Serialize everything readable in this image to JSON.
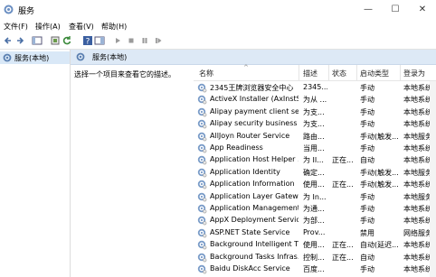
{
  "window": {
    "title": "服务",
    "minimize": "—",
    "maximize": "☐",
    "close": "✕"
  },
  "menu": [
    {
      "label": "文件(F)"
    },
    {
      "label": "操作(A)"
    },
    {
      "label": "查看(V)"
    },
    {
      "label": "帮助(H)"
    }
  ],
  "tree": {
    "item": "服务(本地)"
  },
  "header": {
    "label": "服务(本地)"
  },
  "description": {
    "text": "选择一个项目来查看它的描述。"
  },
  "table": {
    "columns": [
      "名称",
      "描述",
      "状态",
      "启动类型",
      "登录为"
    ],
    "rows": [
      {
        "name": "2345王牌浏览器安全中心",
        "desc": "2345...",
        "status": "",
        "startup": "手动",
        "logon": "本地系统"
      },
      {
        "name": "ActiveX Installer (AxInstSV)",
        "desc": "为从 ...",
        "status": "",
        "startup": "手动",
        "logon": "本地系统"
      },
      {
        "name": "Alipay payment client sec...",
        "desc": "为支...",
        "status": "",
        "startup": "手动",
        "logon": "本地系统"
      },
      {
        "name": "Alipay security business s...",
        "desc": "为支...",
        "status": "",
        "startup": "手动",
        "logon": "本地系统"
      },
      {
        "name": "AllJoyn Router Service",
        "desc": "路由...",
        "status": "",
        "startup": "手动(触发...",
        "logon": "本地服务"
      },
      {
        "name": "App Readiness",
        "desc": "当用...",
        "status": "",
        "startup": "手动",
        "logon": "本地系统"
      },
      {
        "name": "Application Host Helper ...",
        "desc": "为 II...",
        "status": "正在...",
        "startup": "自动",
        "logon": "本地系统"
      },
      {
        "name": "Application Identity",
        "desc": "确定...",
        "status": "",
        "startup": "手动(触发...",
        "logon": "本地服务"
      },
      {
        "name": "Application Information",
        "desc": "使用...",
        "status": "正在...",
        "startup": "手动(触发...",
        "logon": "本地系统"
      },
      {
        "name": "Application Layer Gatewa...",
        "desc": "为 In...",
        "status": "",
        "startup": "手动",
        "logon": "本地服务"
      },
      {
        "name": "Application Management",
        "desc": "为通...",
        "status": "",
        "startup": "手动",
        "logon": "本地系统"
      },
      {
        "name": "AppX Deployment Servic...",
        "desc": "为部...",
        "status": "",
        "startup": "手动",
        "logon": "本地系统"
      },
      {
        "name": "ASP.NET State Service",
        "desc": "Prov...",
        "status": "",
        "startup": "禁用",
        "logon": "网络服务"
      },
      {
        "name": "Background Intelligent T...",
        "desc": "使用...",
        "status": "正在...",
        "startup": "自动(延迟...",
        "logon": "本地系统"
      },
      {
        "name": "Background Tasks Infras...",
        "desc": "控制...",
        "status": "正在...",
        "startup": "自动",
        "logon": "本地系统"
      },
      {
        "name": "Baidu DiskAcc Service",
        "desc": "百度...",
        "status": "",
        "startup": "手动",
        "logon": "本地系统"
      }
    ]
  },
  "colors": {
    "selection": "#d9e8f7",
    "header_band": "#dde9f6",
    "gear": "#5a7fb0"
  },
  "icons": [
    "services-app-icon",
    "back-icon",
    "forward-icon",
    "console-tree-icon",
    "properties-icon",
    "refresh-icon",
    "export-icon",
    "help-icon",
    "show-hide-icon",
    "play-icon",
    "stop-icon",
    "pause-icon",
    "restart-icon",
    "service-gear-icon"
  ]
}
